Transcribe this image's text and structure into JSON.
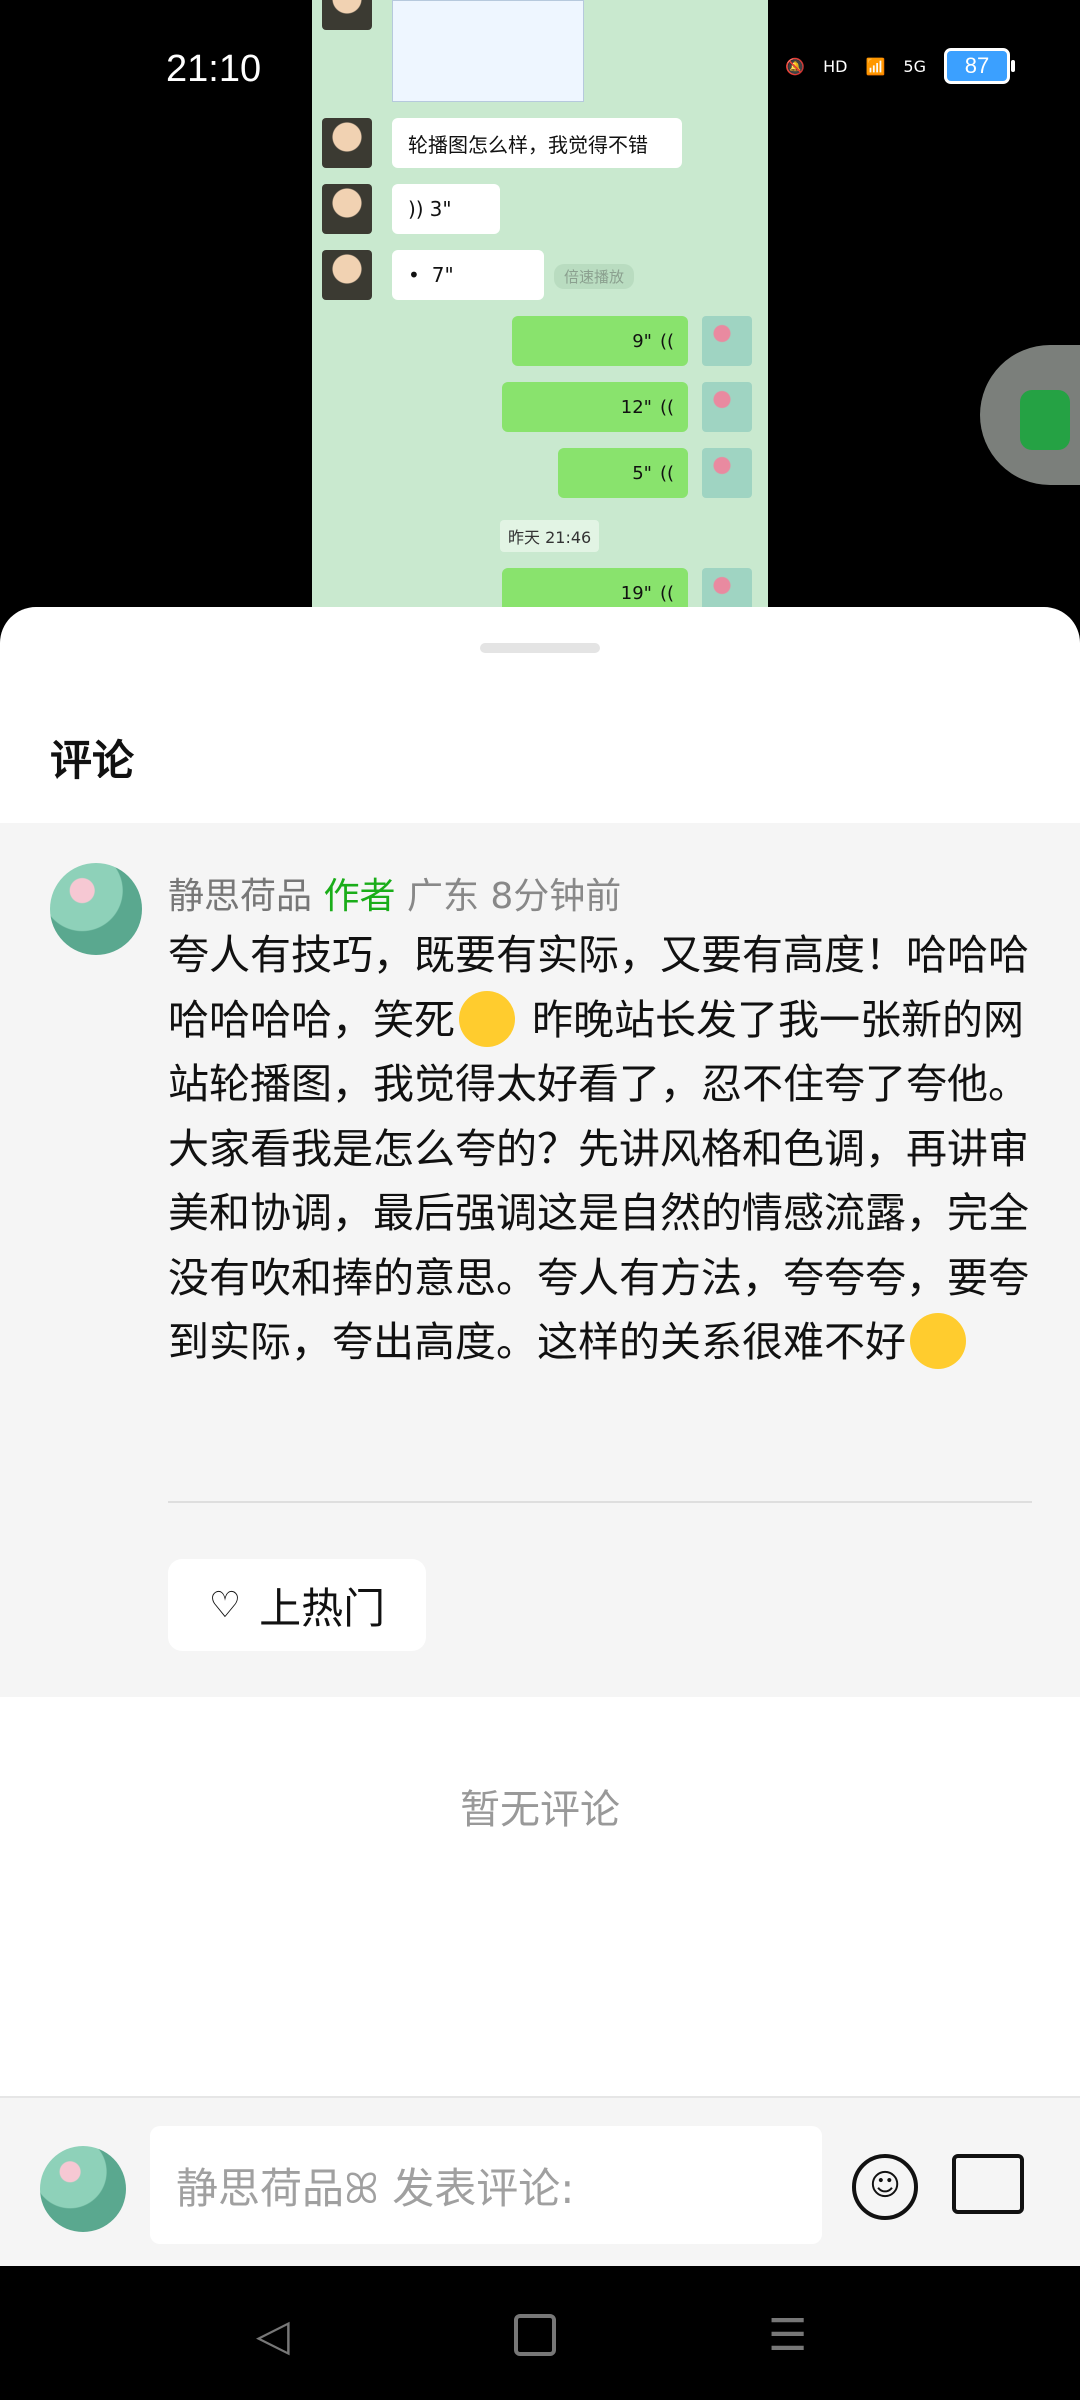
{
  "status_bar": {
    "time": "21:10",
    "network": "5G",
    "hd": "HD",
    "battery": "87"
  },
  "screenshot": {
    "messages": [
      {
        "side": "in",
        "text": "轮播图怎么样，我觉得不错"
      },
      {
        "side": "in",
        "text": "3\""
      },
      {
        "side": "in",
        "text": "7\""
      }
    ],
    "speed_play_label": "倍速播放",
    "out_voice": [
      "9\"",
      "12\"",
      "5\"",
      "19\""
    ],
    "timestamp": "昨天 21:46"
  },
  "sheet": {
    "title": "评论",
    "comment": {
      "username": "静思荷品",
      "author_tag": "作者",
      "location": "广东",
      "time": "8分钟前",
      "body_part1": "夸人有技巧，既要有实际，又要有高度！哈哈哈哈哈哈哈，笑死",
      "body_part2": " 昨晚站长发了我一张新的网站轮播图，我觉得太好看了，忍不住夸了夸他。大家看我是怎么夸的？先讲风格和色调，再讲审美和协调，最后强调这是自然的情感流露，完全没有吹和捧的意思。夸人有方法，夸夸夸，要夸到实际，夸出高度。这样的关系很难不好",
      "hot_button": "上热门"
    },
    "empty_text": "暂无评论"
  },
  "composer": {
    "placeholder": "静思荷品ꕤ 发表评论:"
  }
}
